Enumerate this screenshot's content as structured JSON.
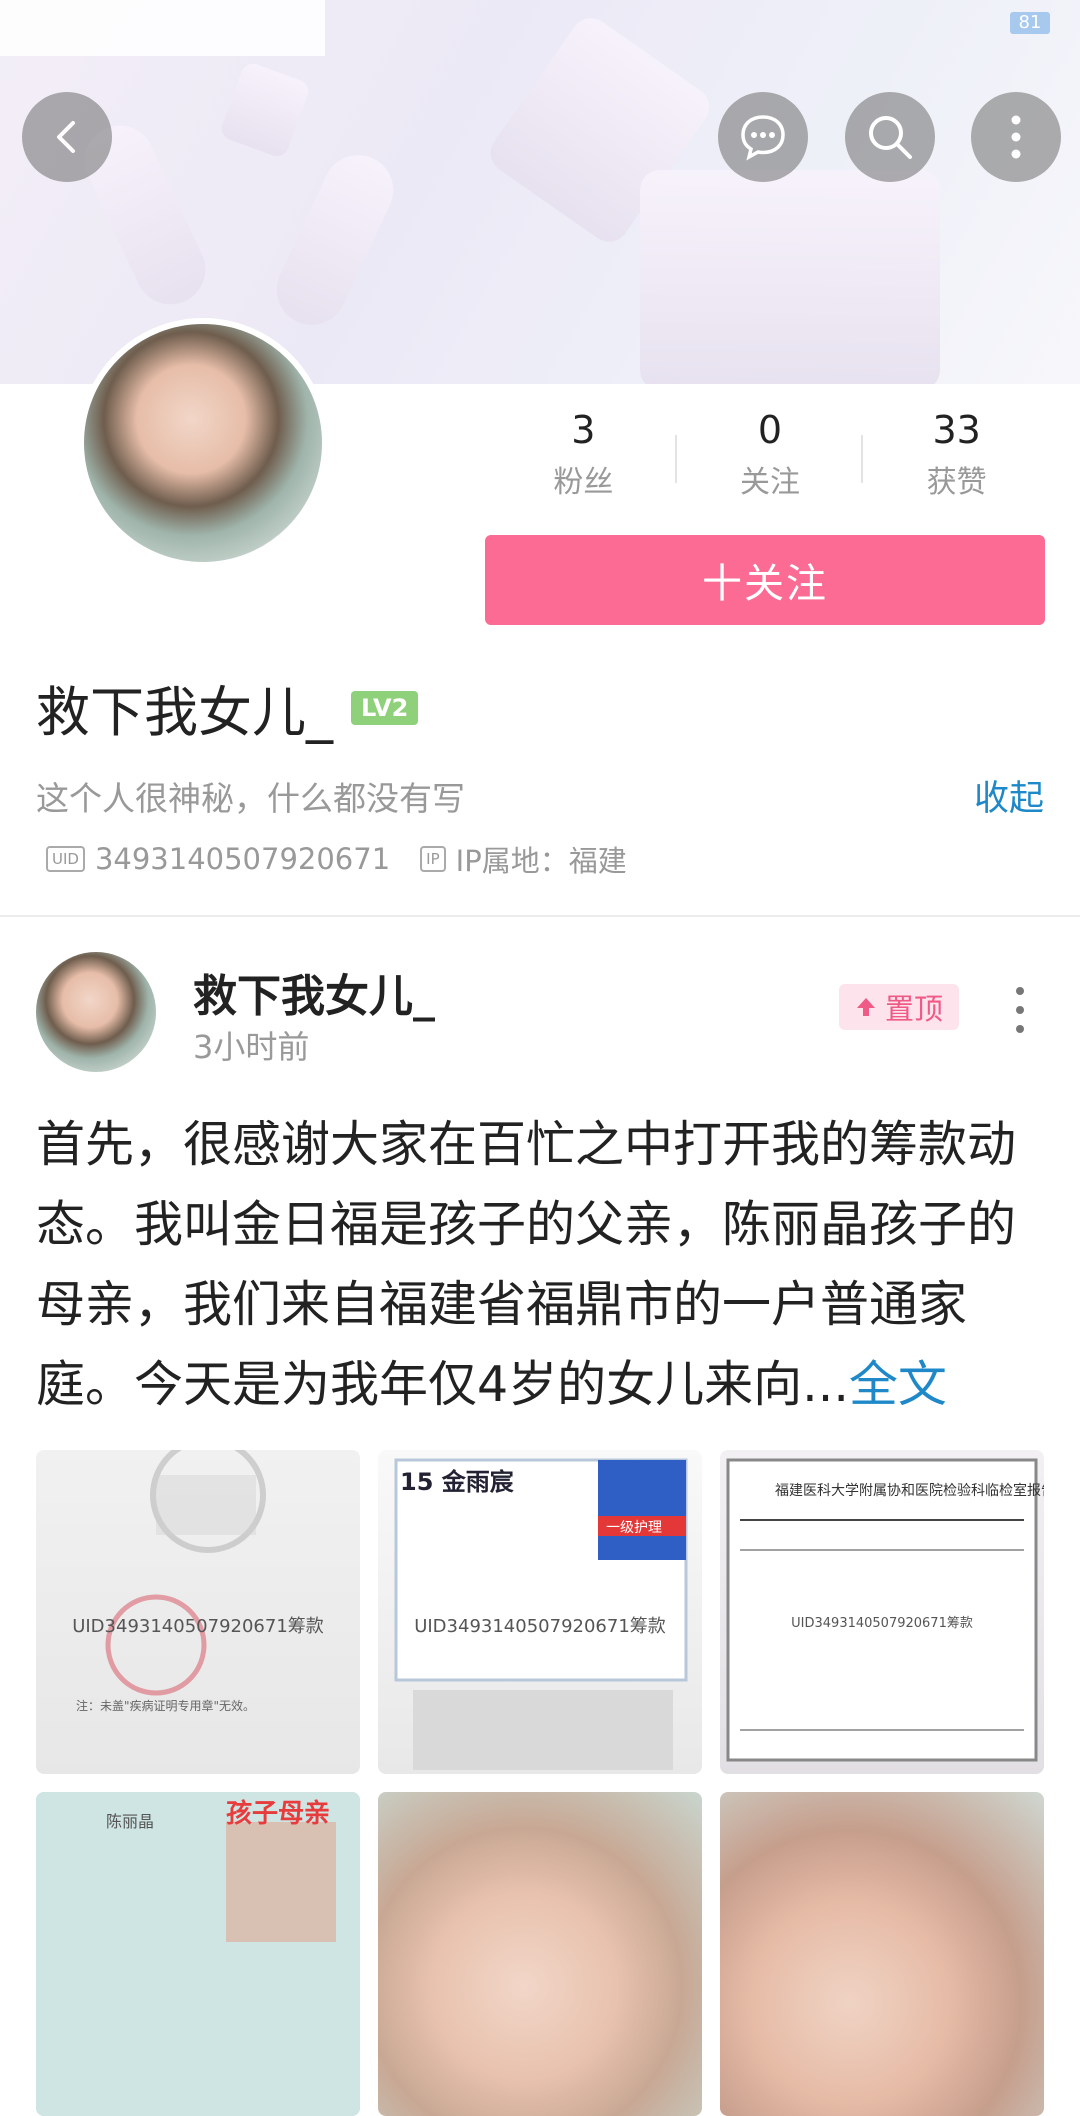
{
  "status": {
    "battery": "81"
  },
  "header": {
    "back": "back",
    "message": "message",
    "search": "search",
    "more": "more"
  },
  "stats": {
    "fans": {
      "num": "3",
      "label": "粉丝"
    },
    "follow": {
      "num": "0",
      "label": "关注"
    },
    "likes": {
      "num": "33",
      "label": "获赞"
    }
  },
  "follow_button": "十关注",
  "profile": {
    "name": "救下我女儿_",
    "level": "LV2",
    "bio": "这个人很神秘，什么都没有写",
    "collapse": "收起",
    "uid": "3493140507920671",
    "uid_tag": "UID",
    "ip_tag": "IP",
    "ip": "IP属地：福建"
  },
  "post": {
    "author": "救下我女儿_",
    "time": "3小时前",
    "pin": "置顶",
    "text_lines": [
      "首先，很感谢大家在百忙之中打开我的筹款动",
      "态。我叫金日福是孩子的父亲，陈丽晶孩子的",
      "母亲，我们来自福建省福鼎市的一户普通家",
      "庭。今天是为我年仅4岁的女儿来向..."
    ],
    "more": "全文",
    "images": [
      {
        "caption": "UID3493140507920671筹款"
      },
      {
        "caption": "UID3493140507920671筹款"
      },
      {
        "caption": "UID3493140507920671筹款"
      },
      {
        "caption": ""
      },
      {
        "caption": ""
      },
      {
        "caption": ""
      }
    ]
  },
  "colors": {
    "accent": "#fb6b93",
    "link": "#1e88c8",
    "level": "#8fd07a"
  }
}
